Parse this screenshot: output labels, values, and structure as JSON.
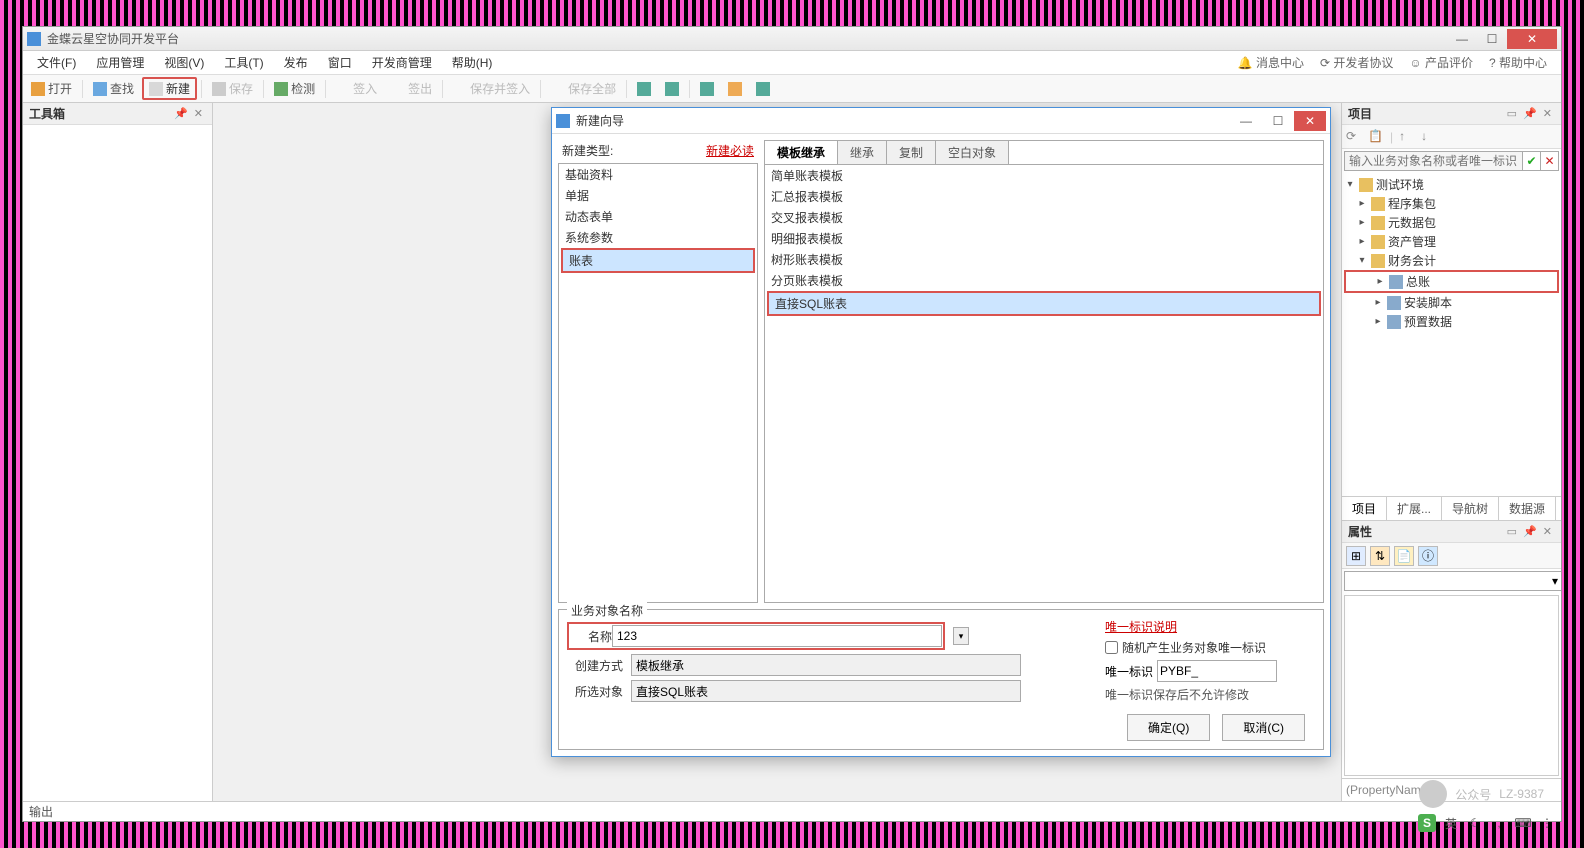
{
  "app": {
    "title": "金蝶云星空协同开发平台"
  },
  "winbtns": {
    "min": "—",
    "max": "☐",
    "close": "✕"
  },
  "menu": {
    "items": [
      "文件(F)",
      "应用管理",
      "视图(V)",
      "工具(T)",
      "发布",
      "窗口",
      "开发商管理",
      "帮助(H)"
    ]
  },
  "menuright": {
    "msg": "消息中心",
    "dev": "开发者协议",
    "rate": "产品评价",
    "help": "帮助中心"
  },
  "toolbar": {
    "open": "打开",
    "find": "查找",
    "new": "新建",
    "save": "保存",
    "check": "检测",
    "checkin": "签入",
    "checkout": "签出",
    "savecheckin": "保存并签入",
    "saveall": "保存全部"
  },
  "toolbox": {
    "title": "工具箱"
  },
  "output": {
    "title": "输出"
  },
  "dialog": {
    "title": "新建向导",
    "typelabel": "新建类型:",
    "newlink": "新建必读",
    "types": [
      "基础资料",
      "单据",
      "动态表单",
      "系统参数",
      "账表"
    ],
    "tabs": [
      "模板继承",
      "继承",
      "复制",
      "空白对象"
    ],
    "templates": [
      "简单账表模板",
      "汇总报表模板",
      "交叉报表模板",
      "明细报表模板",
      "树形账表模板",
      "分页账表模板",
      "直接SQL账表"
    ],
    "group": "业务对象名称",
    "namelabel": "名称",
    "namevalue": "123",
    "createlabel": "创建方式",
    "createvalue": "模板继承",
    "objlabel": "所选对象",
    "objvalue": "直接SQL账表",
    "idinfo": "唯一标识说明",
    "randchk": "随机产生业务对象唯一标识",
    "idlabel": "唯一标识",
    "idvalue": "PYBF_",
    "idnote": "唯一标识保存后不允许修改",
    "ok": "确定(Q)",
    "cancel": "取消(C)"
  },
  "project": {
    "title": "项目",
    "searchph": "输入业务对象名称或者唯一标识",
    "tree": [
      {
        "d": 0,
        "exp": "▾",
        "label": "测试环境",
        "icon": "folder"
      },
      {
        "d": 1,
        "exp": "▸",
        "label": "程序集包",
        "icon": "folder"
      },
      {
        "d": 1,
        "exp": "▸",
        "label": "元数据包",
        "icon": "folder"
      },
      {
        "d": 1,
        "exp": "▸",
        "label": "资产管理",
        "icon": "folder"
      },
      {
        "d": 1,
        "exp": "▾",
        "label": "财务会计",
        "icon": "folder"
      },
      {
        "d": 2,
        "exp": "▸",
        "label": "总账",
        "icon": "item",
        "hl": true
      },
      {
        "d": 2,
        "exp": "▸",
        "label": "安装脚本",
        "icon": "item"
      },
      {
        "d": 2,
        "exp": "▸",
        "label": "预置数据",
        "icon": "item"
      }
    ],
    "tabs": [
      "项目",
      "扩展...",
      "导航树",
      "数据源"
    ]
  },
  "props": {
    "title": "属性",
    "name": "(PropertyName)"
  },
  "watermark": {
    "label": "公众号",
    "id": "LZ-9387"
  },
  "ime": {
    "lang": "英"
  }
}
